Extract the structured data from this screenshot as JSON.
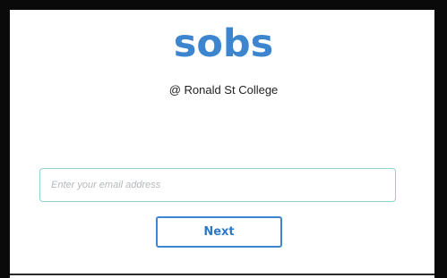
{
  "brand": {
    "logo_text": "sobs",
    "color": "#3d86cf"
  },
  "school": {
    "subtitle": "@ Ronald St College"
  },
  "login": {
    "email_placeholder": "Enter your email address",
    "email_value": "",
    "next_label": "Next"
  },
  "colors": {
    "input_border": "#8fd3cf",
    "frame": "#0a0a0a"
  }
}
